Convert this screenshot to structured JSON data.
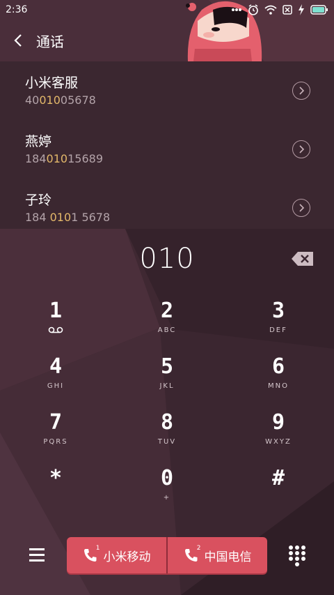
{
  "status_bar": {
    "time": "2:36",
    "icons": [
      "more-dots-icon",
      "alarm-icon",
      "wifi-icon",
      "sim-off-icon",
      "charging-icon",
      "battery-icon"
    ]
  },
  "header": {
    "title": "通话",
    "back_icon": "chevron-left-icon"
  },
  "contacts": [
    {
      "name": "小米客服",
      "number_prefix": "40",
      "number_match": "010",
      "number_suffix": "05678"
    },
    {
      "name": "燕婷",
      "number_prefix": "184",
      "number_match": "010",
      "number_suffix": "15689"
    },
    {
      "name": "子玲",
      "number_prefix": "184 ",
      "number_match": "010",
      "number_suffix": "1 5678"
    }
  ],
  "dial": {
    "number": "010"
  },
  "keypad": [
    [
      {
        "digit": "1",
        "letters": "",
        "icon": "voicemail-icon"
      },
      {
        "digit": "2",
        "letters": "ABC"
      },
      {
        "digit": "3",
        "letters": "DEF"
      }
    ],
    [
      {
        "digit": "4",
        "letters": "GHI"
      },
      {
        "digit": "5",
        "letters": "JKL"
      },
      {
        "digit": "6",
        "letters": "MNO"
      }
    ],
    [
      {
        "digit": "7",
        "letters": "PQRS"
      },
      {
        "digit": "8",
        "letters": "TUV"
      },
      {
        "digit": "9",
        "letters": "WXYZ"
      }
    ],
    [
      {
        "digit": "*",
        "letters": ""
      },
      {
        "digit": "0",
        "letters": "+"
      },
      {
        "digit": "#",
        "letters": ""
      }
    ]
  ],
  "bottom_bar": {
    "call_sim1": {
      "label": "小米移动",
      "sim": "1"
    },
    "call_sim2": {
      "label": "中国电信",
      "sim": "2"
    }
  },
  "colors": {
    "accent": "#d9515f",
    "highlight": "#e3b86a",
    "background": "#3a2630"
  }
}
